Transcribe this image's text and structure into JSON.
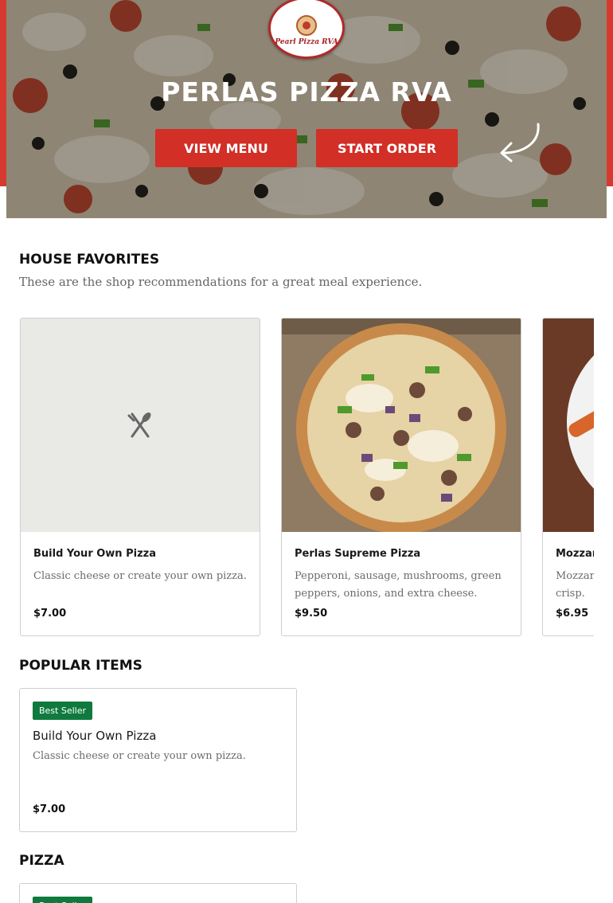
{
  "hero": {
    "logo_text": "Pearl Pizza RVA",
    "title": "PERLAS PIZZA RVA",
    "view_menu_label": "VIEW MENU",
    "start_order_label": "START ORDER"
  },
  "house_favorites": {
    "title": "HOUSE FAVORITES",
    "subtitle": "These are the shop recommendations for a great meal experience.",
    "items": [
      {
        "name": "Build Your Own Pizza",
        "description": "Classic cheese or create your own pizza.",
        "price": "$7.00",
        "image": "placeholder-utensils-icon"
      },
      {
        "name": "Perlas Supreme Pizza",
        "description": "Pepperoni, sausage, mushrooms, green peppers, onions, and extra cheese.",
        "price": "$9.50",
        "image": "supreme-pizza-photo"
      },
      {
        "name": "Mozzarella Sticks",
        "description": "Mozzarella sticks served to a perfect crisp.",
        "price": "$6.95",
        "image": "mozzarella-sticks-photo"
      }
    ]
  },
  "popular_items": {
    "title": "POPULAR ITEMS",
    "items": [
      {
        "badge": "Best Seller",
        "name": "Build Your Own Pizza",
        "description": "Classic cheese or create your own pizza.",
        "price": "$7.00"
      }
    ]
  },
  "pizza": {
    "title": "PIZZA",
    "items": [
      {
        "badge": "Best Seller"
      }
    ]
  },
  "colors": {
    "brand_red": "#d22f27",
    "badge_green": "#107a3e"
  }
}
